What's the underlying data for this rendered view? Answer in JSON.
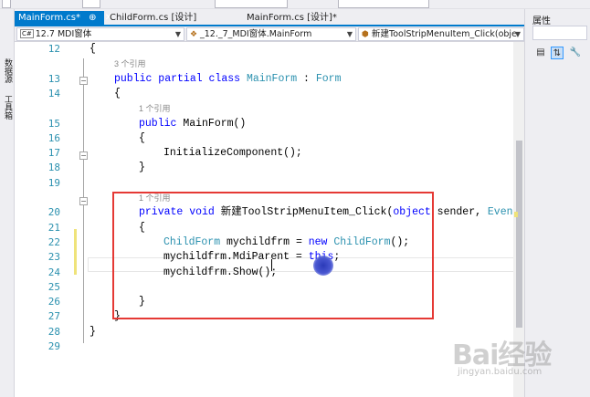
{
  "tabs": [
    {
      "label": "MainForm.cs*",
      "pin": "⊕",
      "close": "✕"
    },
    {
      "label": "ChildForm.cs [设计]"
    },
    {
      "label": "MainForm.cs [设计]*"
    }
  ],
  "left_strip": {
    "items": [
      "数据源",
      "工具箱"
    ]
  },
  "nav": {
    "project": "12.7 MDI窗体",
    "project_badge": "C#",
    "class": "_12._7_MDI窗体.MainForm",
    "member": "新建ToolStripMenuItem_Click(obje"
  },
  "properties": {
    "title": "属性",
    "buttons": [
      "categorized-icon",
      "alphabetical-icon",
      "wrench-icon"
    ]
  },
  "editor": {
    "lines": [
      {
        "n": "12",
        "code": "{",
        "indent": 1
      },
      {
        "ref": "3 个引用",
        "indent": 2
      },
      {
        "n": "13",
        "tokens": [
          {
            "t": "public partial class ",
            "c": "kw"
          },
          {
            "t": "MainForm",
            "c": "ty"
          },
          {
            "t": " : "
          },
          {
            "t": "Form",
            "c": "ty"
          }
        ],
        "indent": 2
      },
      {
        "n": "14",
        "code": "{",
        "indent": 2
      },
      {
        "ref": "1 个引用",
        "indent": 3
      },
      {
        "n": "15",
        "tokens": [
          {
            "t": "public ",
            "c": "kw"
          },
          {
            "t": "MainForm()"
          }
        ],
        "indent": 3
      },
      {
        "n": "16",
        "code": "{",
        "indent": 3
      },
      {
        "n": "17",
        "code": "InitializeComponent();",
        "indent": 4
      },
      {
        "n": "18",
        "code": "}",
        "indent": 3
      },
      {
        "n": "19",
        "code": "",
        "indent": 0
      },
      {
        "ref": "1 个引用",
        "indent": 3
      },
      {
        "n": "20",
        "tokens": [
          {
            "t": "private void ",
            "c": "kw"
          },
          {
            "t": "新建ToolStripMenuItem_Click("
          },
          {
            "t": "object",
            "c": "kw"
          },
          {
            "t": " sender, "
          },
          {
            "t": "EventA",
            "c": "ty"
          }
        ],
        "indent": 3
      },
      {
        "n": "21",
        "code": "{",
        "indent": 3
      },
      {
        "n": "22",
        "tokens": [
          {
            "t": "ChildForm",
            "c": "ty"
          },
          {
            "t": " mychildfrm = "
          },
          {
            "t": "new ",
            "c": "kw"
          },
          {
            "t": "ChildForm",
            "c": "ty"
          },
          {
            "t": "();"
          }
        ],
        "indent": 4
      },
      {
        "n": "23",
        "tokens": [
          {
            "t": "mychildfrm.MdiParent = "
          },
          {
            "t": "this",
            "c": "kw"
          },
          {
            "t": ";"
          }
        ],
        "indent": 4
      },
      {
        "n": "24",
        "code": "mychildfrm.Show();",
        "indent": 4
      },
      {
        "n": "25",
        "code": "",
        "indent": 0
      },
      {
        "n": "26",
        "code": "}",
        "indent": 3
      },
      {
        "n": "27",
        "code": "}",
        "indent": 2
      },
      {
        "n": "28",
        "code": "}",
        "indent": 1
      },
      {
        "n": "29",
        "code": "",
        "indent": 0
      }
    ]
  },
  "colors": {
    "accent": "#007acc",
    "keyword": "#0000ff",
    "type": "#2b91af",
    "highlight": "#e53935"
  },
  "watermark": {
    "brand": "Bai经验",
    "site": "jingyan.baidu.com"
  }
}
